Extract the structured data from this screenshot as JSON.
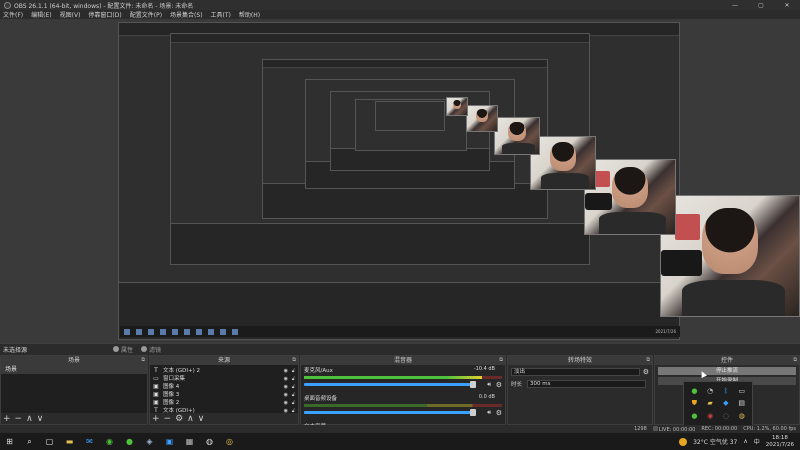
{
  "window": {
    "title": "OBS 26.1.1 (64-bit, windows) - 配置文件: 未命名 - 场景: 未命名",
    "controls": [
      "—",
      "▢",
      "✕"
    ]
  },
  "menu": [
    "文件(F)",
    "编辑(E)",
    "视图(V)",
    "停靠窗口(D)",
    "配置文件(P)",
    "场景集合(S)",
    "工具(T)",
    "帮助(H)"
  ],
  "inner_clock": "2021/7/26",
  "toolbar": {
    "scene_label": "未选择源",
    "properties": "属性",
    "filters": "滤镜"
  },
  "scenes": {
    "title": "场景",
    "items": [
      "场景"
    ],
    "controls": [
      "+",
      "−",
      "∧",
      "∨"
    ]
  },
  "sources": {
    "title": "来源",
    "items": [
      {
        "icon": "T",
        "label": "文本 (GDI+) 2"
      },
      {
        "icon": "▭",
        "label": "窗口采集"
      },
      {
        "icon": "▣",
        "label": "图像 4"
      },
      {
        "icon": "▣",
        "label": "图像 3"
      },
      {
        "icon": "▣",
        "label": "图像 2"
      },
      {
        "icon": "T",
        "label": "文本 (GDI+)"
      }
    ],
    "controls": [
      "+",
      "−",
      "⚙",
      "∧",
      "∨"
    ]
  },
  "mixer": {
    "title": "混音器",
    "channels": [
      {
        "name": "麦克风/Aux",
        "db": "-10.4 dB",
        "level": 0.9
      },
      {
        "name": "桌面音频设备",
        "db": "0.0 dB",
        "level": 0.0
      }
    ],
    "footer": "文本字幕"
  },
  "transitions": {
    "title": "转场特效",
    "type": "淡出",
    "duration_label": "时长",
    "duration": "300 ms"
  },
  "controls": {
    "title": "控件",
    "buttons": [
      "停止推流",
      "开始录制"
    ]
  },
  "status": {
    "live": "LIVE: 00:00:00",
    "rec": "REC: 00:00:00",
    "cpu": "CPU: 1.2%, 60.00 fps",
    "prefix": "1298"
  },
  "taskbar": {
    "weather": "32°C 空气优 37",
    "time": "18:18",
    "date": "2021/7/26",
    "ime": "中"
  },
  "colors": {
    "accent": "#3ba0ff",
    "meter_green": "#4fc23c",
    "meter_yellow": "#e0d030",
    "meter_red": "#6a2a2a"
  }
}
